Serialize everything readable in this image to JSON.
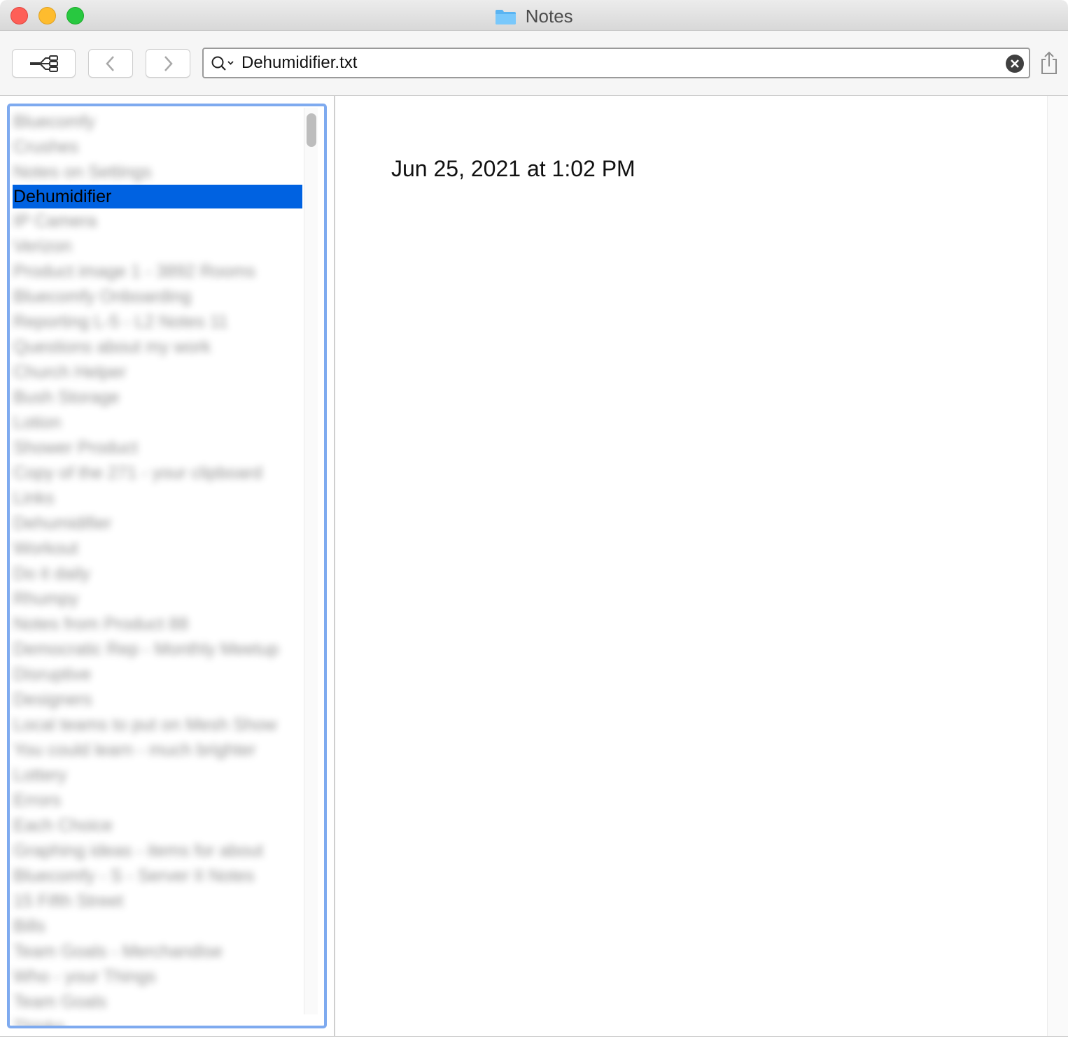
{
  "window": {
    "title": "Notes"
  },
  "toolbar": {
    "search": {
      "value": "Dehumidifier.txt"
    }
  },
  "sidebar": {
    "items": [
      {
        "label": "Bluecomfy",
        "blurred": true
      },
      {
        "label": "Crushes",
        "blurred": true
      },
      {
        "label": "Notes on Settings",
        "blurred": true
      },
      {
        "label": "Dehumidifier",
        "blurred": false,
        "selected": true
      },
      {
        "label": "IP Camera",
        "blurred": true
      },
      {
        "label": "Verizon",
        "blurred": true
      },
      {
        "label": "Product image 1 - 3892 Rooms",
        "blurred": true
      },
      {
        "label": "Bluecomfy Onboarding",
        "blurred": true
      },
      {
        "label": "Reporting L-5 - L2 Notes 11",
        "blurred": true
      },
      {
        "label": "Questions about my work",
        "blurred": true
      },
      {
        "label": "Church Helper",
        "blurred": true
      },
      {
        "label": "Bush Storage",
        "blurred": true
      },
      {
        "label": "Lotion",
        "blurred": true
      },
      {
        "label": "Shower Product",
        "blurred": true
      },
      {
        "label": "Copy of the 271 - your clipboard",
        "blurred": true
      },
      {
        "label": "Links",
        "blurred": true
      },
      {
        "label": "Dehumidifier",
        "blurred": true
      },
      {
        "label": "Workout",
        "blurred": true
      },
      {
        "label": "Do it daily",
        "blurred": true
      },
      {
        "label": "Rhumpy",
        "blurred": true
      },
      {
        "label": "Notes from Product 88",
        "blurred": true
      },
      {
        "label": "Democratic Rep - Monthly Meetup",
        "blurred": true
      },
      {
        "label": "Disruptive",
        "blurred": true
      },
      {
        "label": "Designers",
        "blurred": true
      },
      {
        "label": "Local teams to put on Mesh Show",
        "blurred": true
      },
      {
        "label": "You could learn - much brighter",
        "blurred": true
      },
      {
        "label": "Lottery",
        "blurred": true
      },
      {
        "label": "Errors",
        "blurred": true
      },
      {
        "label": "Each Choice",
        "blurred": true
      },
      {
        "label": "Graphing ideas - items for about",
        "blurred": true
      },
      {
        "label": "Bluecomfy - S - Server II Notes",
        "blurred": true
      },
      {
        "label": "15 Fifth Street",
        "blurred": true
      },
      {
        "label": "Bills",
        "blurred": true
      },
      {
        "label": "Team Goals - Merchandise",
        "blurred": true
      },
      {
        "label": "Who - your Things",
        "blurred": true
      },
      {
        "label": "Team Goals",
        "blurred": true
      },
      {
        "label": "Thinks",
        "blurred": true
      }
    ]
  },
  "content": {
    "timestamp": "Jun 25, 2021 at 1:02 PM"
  },
  "colors": {
    "selection": "#0062e1",
    "focus_ring": "#7eaaef",
    "close": "#fe5f57",
    "minimize": "#febc2e",
    "maximize": "#28c840"
  },
  "icons": {
    "coverflow": "coverflow-icon",
    "back": "chevron-left-icon",
    "forward": "chevron-right-icon",
    "search": "search-icon",
    "clear": "clear-icon",
    "share": "share-icon",
    "folder": "folder-icon"
  }
}
